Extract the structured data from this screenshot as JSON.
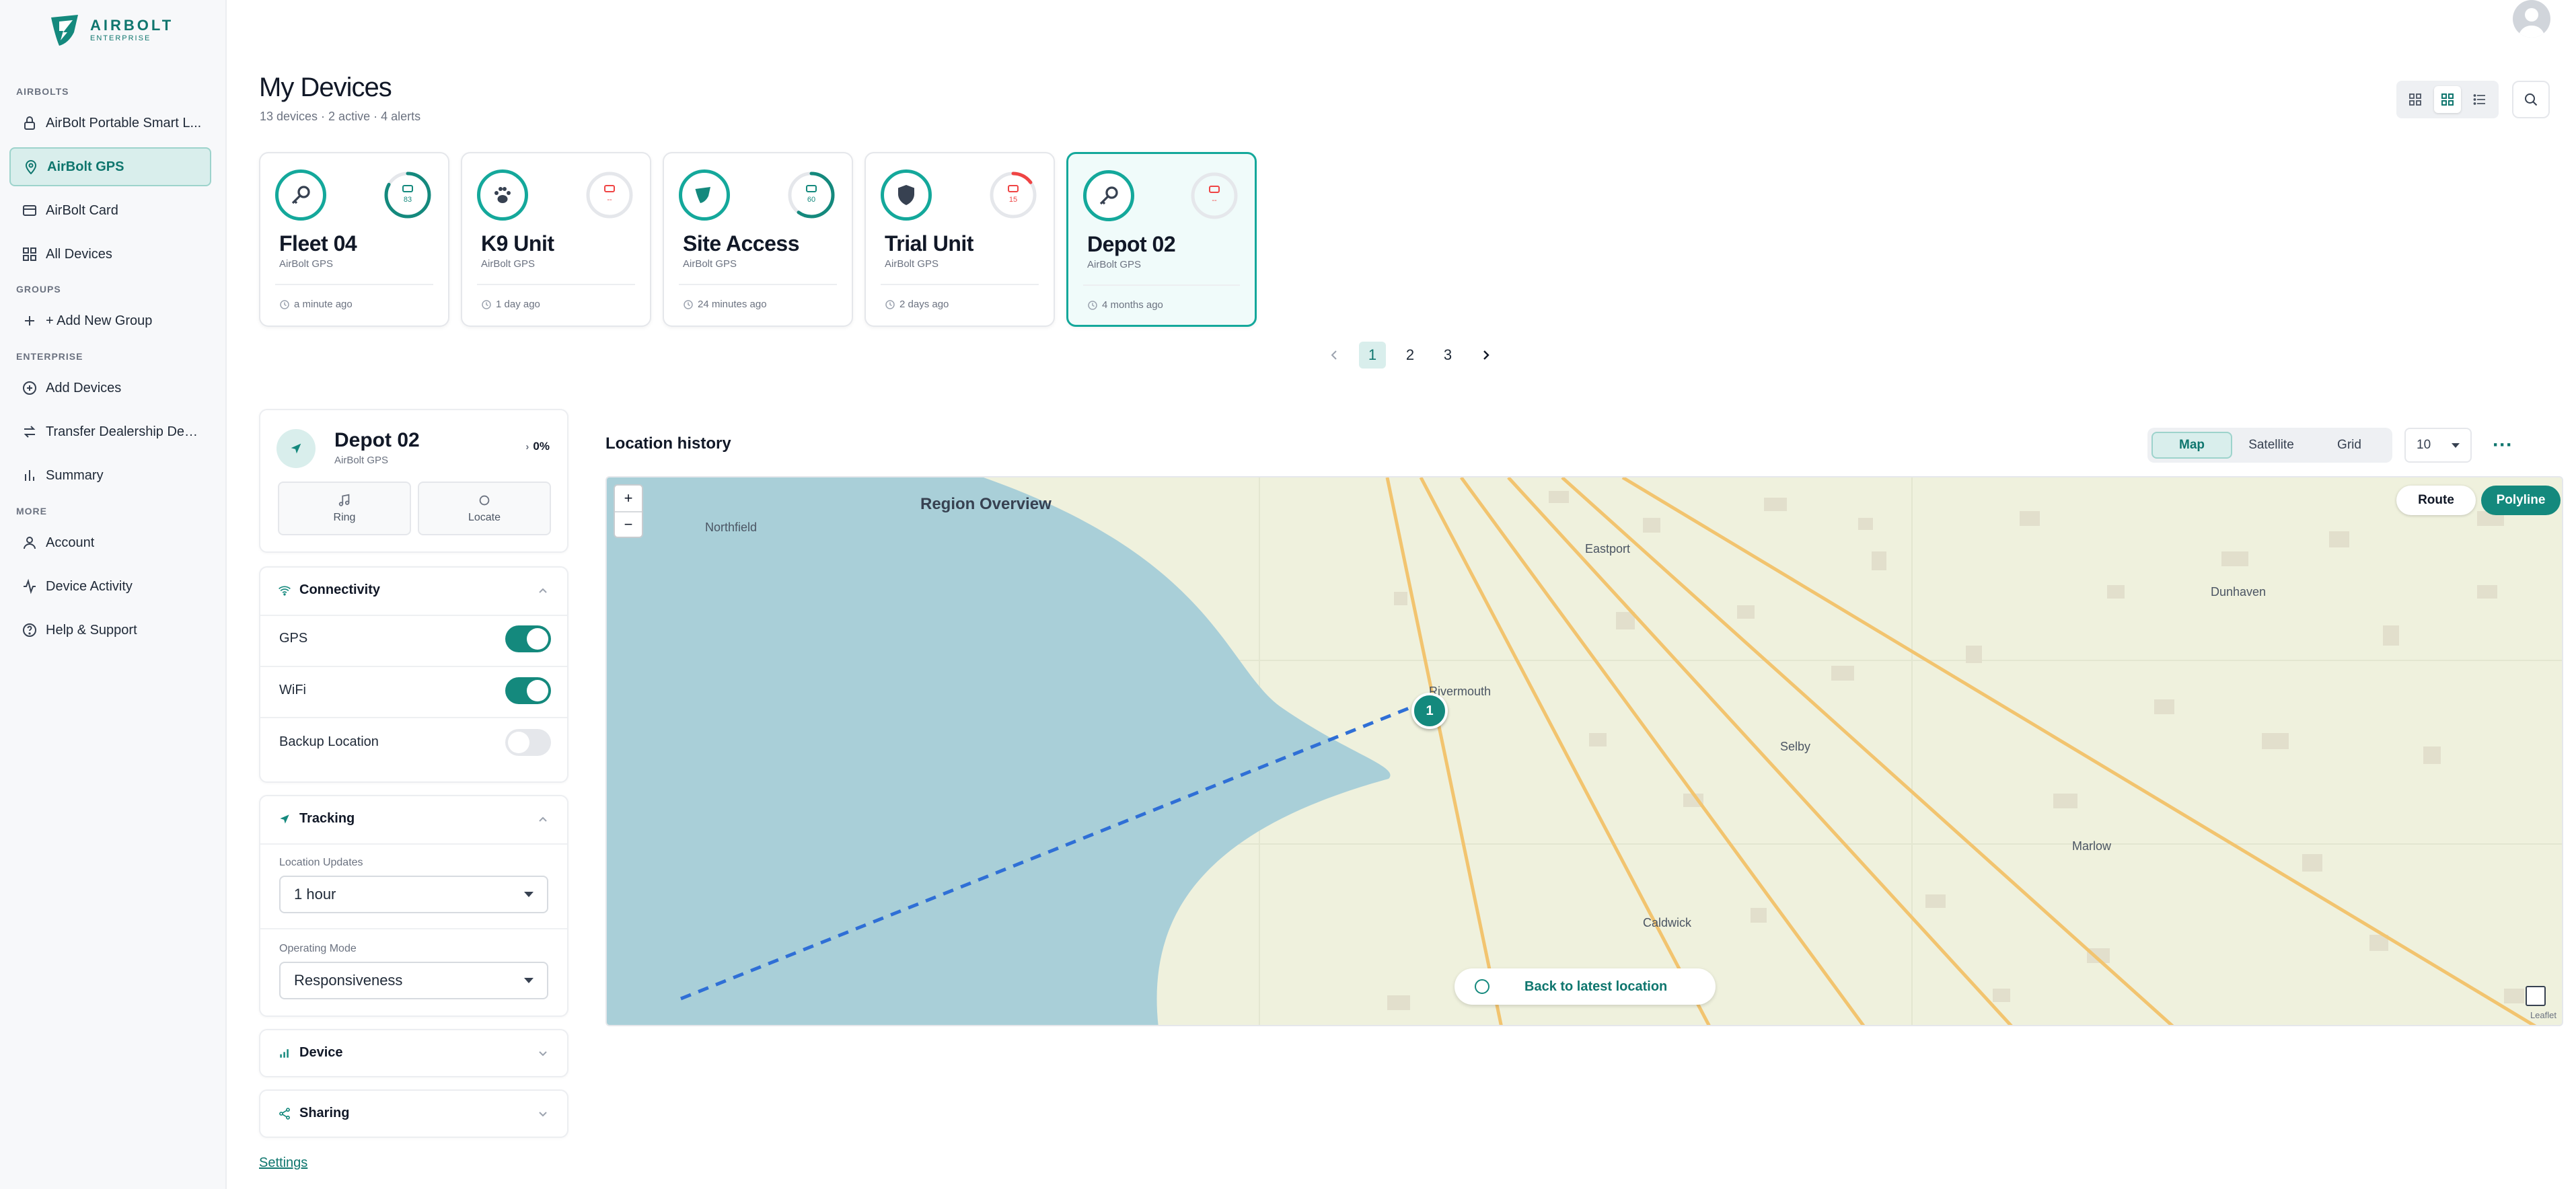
{
  "brand": {
    "name": "AIRBOLT",
    "tier": "ENTERPRISE"
  },
  "sidebar": {
    "sections": {
      "airbolts": "AIRBOLTS",
      "groups": "GROUPS",
      "enterprise": "ENTERPRISE",
      "more": "MORE"
    },
    "items": [
      {
        "label": "AirBolt Portable Smart L...",
        "icon": "lock-icon"
      },
      {
        "label": "AirBolt GPS",
        "icon": "pin-icon",
        "active": true
      },
      {
        "label": "AirBolt Card",
        "icon": "card-icon"
      },
      {
        "label": "All Devices",
        "icon": "grid-icon"
      },
      {
        "label": "+ Add New Group",
        "icon": "plus-icon"
      },
      {
        "label": "Add Devices",
        "icon": "plus-circle-icon"
      },
      {
        "label": "Transfer Dealership Devi...",
        "icon": "transfer-icon"
      },
      {
        "label": "Summary",
        "icon": "bar-chart-icon"
      },
      {
        "label": "Account",
        "icon": "user-icon"
      },
      {
        "label": "Device Activity",
        "icon": "activity-icon"
      },
      {
        "label": "Help & Support",
        "icon": "help-icon"
      }
    ]
  },
  "header": {
    "title": "My Devices",
    "subtitle": "13 devices · 2 active · 4 alerts"
  },
  "devices": [
    {
      "name": "Fleet 04",
      "type": "AirBolt GPS",
      "time": "a minute ago",
      "battery": "83",
      "battery_level": 0.83,
      "icon": "key-icon"
    },
    {
      "name": "K9 Unit",
      "type": "AirBolt GPS",
      "time": "1 day ago",
      "battery": "--",
      "battery_level": 0,
      "icon": "paw-icon"
    },
    {
      "name": "Site Access",
      "type": "AirBolt GPS",
      "time": "24 minutes ago",
      "battery": "60",
      "battery_level": 0.6,
      "icon": "airbolt-logo-icon"
    },
    {
      "name": "Trial Unit",
      "type": "AirBolt GPS",
      "time": "2 days ago",
      "battery": "15",
      "battery_level": 0.15,
      "icon": "shield-icon"
    },
    {
      "name": "Depot 02",
      "type": "AirBolt GPS",
      "time": "4 months ago",
      "battery": "--",
      "battery_level": 0,
      "icon": "key-icon",
      "selected": true
    }
  ],
  "pagination": {
    "pages": [
      "1",
      "2",
      "3"
    ],
    "current": "1"
  },
  "detail": {
    "name": "Depot 02",
    "type": "AirBolt GPS",
    "battery": "0%",
    "actions": {
      "ring": "Ring",
      "locate": "Locate"
    },
    "connectivity": {
      "title": "Connectivity",
      "gps": "GPS",
      "wifi": "WiFi",
      "backup": "Backup Location"
    },
    "tracking": {
      "title": "Tracking",
      "updates_label": "Location Updates",
      "updates_value": "1 hour",
      "mode_label": "Operating Mode",
      "mode_value": "Responsiveness"
    },
    "device_title": "Device",
    "sharing_title": "Sharing",
    "settings_link": "Settings"
  },
  "location": {
    "title": "Location history",
    "modes": [
      "Map",
      "Satellite",
      "Grid"
    ],
    "active_mode": "Map",
    "count": "10",
    "more": "···",
    "map": {
      "title": "Region Overview",
      "zoom_in": "+",
      "zoom_out": "−",
      "route": "Route",
      "polyline": "Polyline",
      "pin_label": "1",
      "back_label": "Back to latest location",
      "attribution": "Leaflet",
      "towns": [
        "Northfield",
        "Eastport",
        "Dunhaven",
        "Rivermouth",
        "Selby",
        "Marlow",
        "Caldwick"
      ]
    }
  },
  "colors": {
    "accent": "#14897d",
    "accent_light": "#d9eeec",
    "alert": "#ef4444",
    "water": "#a9cfd8",
    "land": "#eff1dd",
    "road": "#f2c46f",
    "route": "#2f6fd6"
  }
}
